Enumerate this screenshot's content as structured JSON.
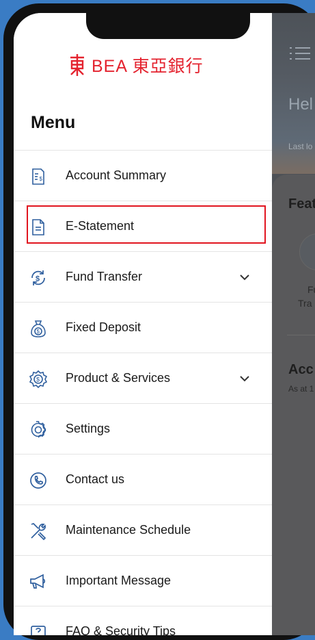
{
  "brand": {
    "name": "BEA",
    "chinese_name": "東亞銀行",
    "color": "#e4232f"
  },
  "menu": {
    "title": "Menu",
    "items": [
      {
        "label": "Account Summary",
        "icon": "account-summary-icon",
        "expandable": false
      },
      {
        "label": "E-Statement",
        "icon": "e-statement-icon",
        "expandable": false,
        "highlighted": true
      },
      {
        "label": "Fund Transfer",
        "icon": "fund-transfer-icon",
        "expandable": true
      },
      {
        "label": "Fixed Deposit",
        "icon": "money-bag-icon",
        "expandable": false
      },
      {
        "label": "Product & Services",
        "icon": "product-services-icon",
        "expandable": true
      },
      {
        "label": "Settings",
        "icon": "gear-icon",
        "expandable": false
      },
      {
        "label": "Contact us",
        "icon": "phone-icon",
        "expandable": false
      },
      {
        "label": "Maintenance Schedule",
        "icon": "tools-icon",
        "expandable": false
      },
      {
        "label": "Important Message",
        "icon": "megaphone-icon",
        "expandable": false
      },
      {
        "label": "FAQ & Security Tips",
        "icon": "faq-icon",
        "expandable": false
      }
    ]
  },
  "background_app": {
    "greeting": "Hel",
    "last_login": "Last lo",
    "features_heading": "Feat",
    "feature_label_line1": "Fu",
    "feature_label_line2": "Tra",
    "accounts_heading": "Acc",
    "as_at": "As at 1"
  },
  "colors": {
    "accent_blue": "#2f5f9e",
    "highlight_border": "#e1141f",
    "page_background": "#3a7cc4"
  }
}
